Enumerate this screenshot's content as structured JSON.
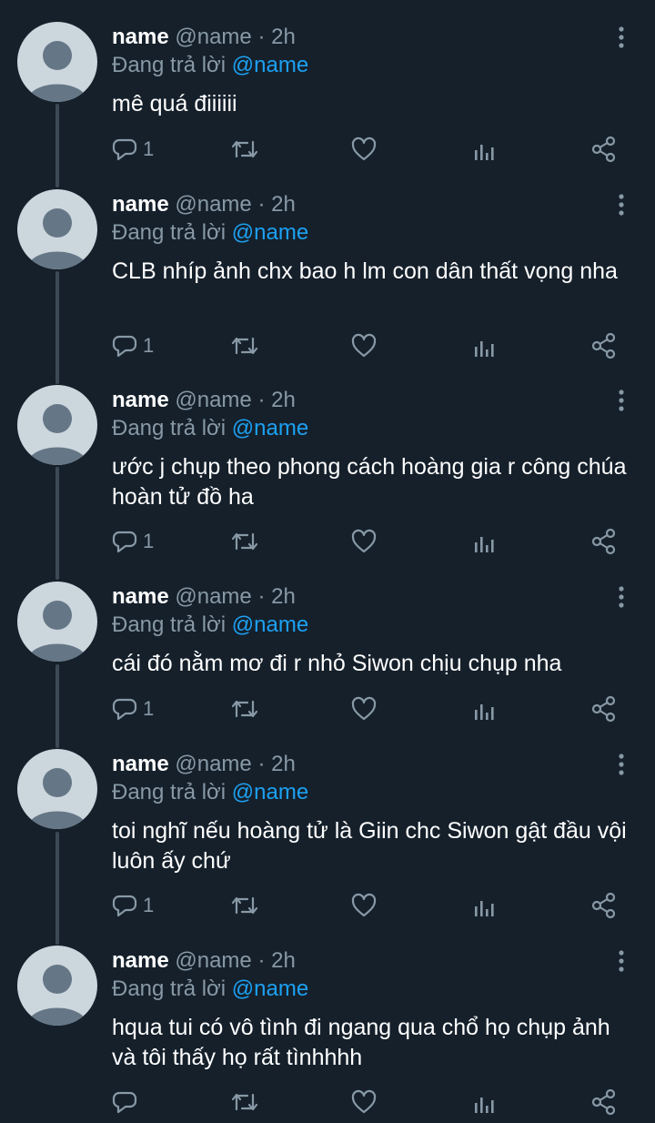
{
  "tweets": [
    {
      "name": "name",
      "handle": "@name",
      "time": "· 2h",
      "replying_prefix": "Đang trả lời",
      "replying_to": "@name",
      "text": "mê quá điiiiii",
      "reply_count": "1"
    },
    {
      "name": "name",
      "handle": "@name",
      "time": "· 2h",
      "replying_prefix": "Đang trả lời",
      "replying_to": "@name",
      "text": "CLB nhíp ảnh chx bao h lm con dân thất vọng nha",
      "reply_count": "1"
    },
    {
      "name": "name",
      "handle": "@name",
      "time": "· 2h",
      "replying_prefix": "Đang trả lời",
      "replying_to": "@name",
      "text": "ước j chụp theo phong cách hoàng gia r công chúa hoàn tử đồ ha",
      "reply_count": "1"
    },
    {
      "name": "name",
      "handle": "@name",
      "time": "· 2h",
      "replying_prefix": "Đang trả lời",
      "replying_to": "@name",
      "text": "cái đó nằm mơ đi r nhỏ Siwon chịu chụp nha",
      "reply_count": "1"
    },
    {
      "name": "name",
      "handle": "@name",
      "time": "· 2h",
      "replying_prefix": "Đang trả lời",
      "replying_to": "@name",
      "text": "toi nghĩ nếu hoàng tử là Giin chc Siwon gật đầu vội luôn ấy chứ",
      "reply_count": "1"
    },
    {
      "name": "name",
      "handle": "@name",
      "time": "· 2h",
      "replying_prefix": "Đang trả lời",
      "replying_to": "@name",
      "text": "hqua tui có vô tình đi ngang qua chổ họ chụp ảnh và tôi thấy họ rất tìnhhhh",
      "reply_count": ""
    }
  ],
  "colors": {
    "background": "#15202b",
    "text": "#ffffff",
    "muted": "#8899a6",
    "mention": "#1da1f2",
    "avatar": "#ccd6dd",
    "avatar_figure": "#657786",
    "thread_line": "#3d4a56"
  },
  "icons": {
    "more": "more-vertical-icon",
    "reply": "reply-bubble-icon",
    "retweet": "retweet-icon",
    "like": "heart-icon",
    "analytics": "analytics-bars-icon",
    "share": "share-icon"
  }
}
